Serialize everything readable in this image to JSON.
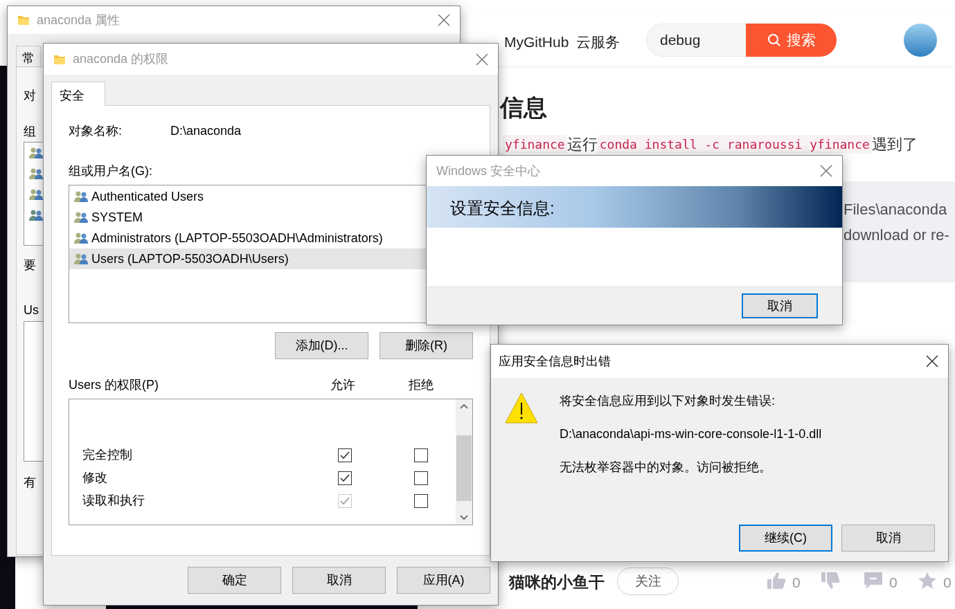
{
  "browser": {
    "nav": [
      "MyGitHub",
      "云服务"
    ],
    "search": {
      "value": "debug"
    },
    "search_button": "搜索",
    "heading": "信息",
    "code_line": [
      {
        "kind": "code",
        "text": "yfinance"
      },
      {
        "kind": "text",
        "text": "运行"
      },
      {
        "kind": "code",
        "text": "conda install -c ranaroussi yfinance"
      },
      {
        "kind": "text",
        "text": "遇到了"
      }
    ],
    "quote_lines": [
      "Files\\anaconda",
      "download or re-"
    ],
    "author": "猫咪的小鱼干",
    "follow_button": "关注",
    "actions": [
      {
        "kind": "like",
        "count": "0"
      },
      {
        "kind": "dislike"
      },
      {
        "kind": "comment",
        "count": "0"
      },
      {
        "kind": "star",
        "count": "0"
      }
    ]
  },
  "properties_window": {
    "title": "anaconda 属性",
    "tab": "常",
    "labels": [
      "对",
      "组",
      "要",
      "Us",
      "有"
    ],
    "user_icons": [
      {
        "selected": false
      },
      {
        "selected": false
      },
      {
        "selected": false
      },
      {
        "selected": true
      }
    ]
  },
  "permissions_window": {
    "title": "anaconda 的权限",
    "tabs": [
      {
        "label": "安全",
        "selected": true
      }
    ],
    "object_label": "对象名称:",
    "object_value": "D:\\anaconda",
    "group_label": "组或用户名(G):",
    "users": [
      {
        "name": "Authenticated Users",
        "selected": false
      },
      {
        "name": "SYSTEM",
        "selected": false
      },
      {
        "name": "Administrators (LAPTOP-5503OADH\\Administrators)",
        "selected": false
      },
      {
        "name": "Users (LAPTOP-5503OADH\\Users)",
        "selected": true
      }
    ],
    "user_buttons": [
      "添加(D)...",
      "删除(R)"
    ],
    "perm_label": "Users 的权限(P)",
    "allow_header": "允许",
    "deny_header": "拒绝",
    "permissions": [
      {
        "name": "完全控制",
        "allow": {
          "checked": true,
          "disabled": false
        },
        "deny": {
          "checked": false,
          "disabled": false
        }
      },
      {
        "name": "修改",
        "allow": {
          "checked": true,
          "disabled": false
        },
        "deny": {
          "checked": false,
          "disabled": false
        }
      },
      {
        "name": "读取和执行",
        "allow": {
          "checked": true,
          "disabled": true
        },
        "deny": {
          "checked": false,
          "disabled": false
        }
      }
    ],
    "buttons": [
      "确定",
      "取消",
      "应用(A)"
    ]
  },
  "security_center": {
    "title": "Windows 安全中心",
    "banner": "设置安全信息:",
    "button": "取消"
  },
  "error_dialog": {
    "title": "应用安全信息时出错",
    "lines": [
      "将安全信息应用到以下对象时发生错误:",
      "D:\\anaconda\\api-ms-win-core-console-l1-1-0.dll",
      "无法枚举容器中的对象。访问被拒绝。"
    ],
    "buttons": [
      {
        "label": "继续(C)",
        "focused": true
      },
      {
        "label": "取消",
        "focused": false
      }
    ]
  }
}
